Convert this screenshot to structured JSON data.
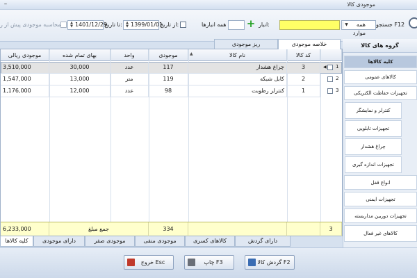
{
  "window": {
    "title": "موجودی کالا",
    "minimize": "–"
  },
  "toolbar": {
    "search_label": "جستجو F12",
    "all_items": "همه موارد",
    "warehouse_label": "انبار:",
    "all_warehouses": "همه انبارها",
    "from_date_label": "از تاریخ:",
    "from_date": "1399/01/01",
    "to_date_label": "تا تاریخ:",
    "to_date": "1401/12/29",
    "calc_prev_label": "محاسبه موجودی پیش از ر"
  },
  "sidebar": {
    "header": "گروه های کالا",
    "items": [
      {
        "label": "کلیه کالاها"
      },
      {
        "label": "کالاهای عمومی"
      },
      {
        "label": "تجهیزات حفاظت الکتریکی"
      },
      {
        "label": "کنترلر و نمایشگر"
      },
      {
        "label": "تجهیزات تابلویی"
      },
      {
        "label": "چراغ هشدار"
      },
      {
        "label": "تجهیزات اندازه گیری"
      },
      {
        "label": "انواع قفل"
      },
      {
        "label": "تجهیزات ایمنی"
      },
      {
        "label": "تجهیزات دوربین مداربسته"
      },
      {
        "label": "کالاهای غیر فعال"
      }
    ]
  },
  "tabs_top": [
    {
      "label": "خلاصه موجودی"
    },
    {
      "label": "ریز موجودی"
    }
  ],
  "grid": {
    "columns": {
      "code": "کد کالا",
      "name": "نام کالا",
      "stock": "موجودی",
      "unit": "واحد",
      "price": "بهای تمام شده",
      "value": "موجودی ریالی"
    },
    "rows": [
      {
        "idx": "1",
        "code": "3",
        "name": "چراغ هشدار",
        "stock": "117",
        "unit": "عدد",
        "price": "30,000",
        "value": "3,510,000"
      },
      {
        "idx": "2",
        "code": "2",
        "name": "کابل شبکه",
        "stock": "119",
        "unit": "متر",
        "price": "13,000",
        "value": "1,547,000"
      },
      {
        "idx": "3",
        "code": "1",
        "name": "کنترلر رطوبت",
        "stock": "98",
        "unit": "عدد",
        "price": "12,000",
        "value": "1,176,000"
      }
    ],
    "footer": {
      "count": "3",
      "stock_total": "334",
      "sum_label": "جمع مبلغ",
      "value_total": "6,233,000"
    }
  },
  "tabs_bottom": [
    {
      "label": "دارای گردش"
    },
    {
      "label": "کالاهای کسری"
    },
    {
      "label": "موجودی منفی"
    },
    {
      "label": "موجودی صفر"
    },
    {
      "label": "دارای موجودی"
    },
    {
      "label": "کلیه کالاها"
    }
  ],
  "buttons": {
    "turnover": "گردش کالا F2",
    "print": "چاپ F3",
    "exit": "خروج Esc"
  },
  "colors": {
    "yellow_input": "#ffff66",
    "plus_green": "#23a123",
    "footer_bg": "#ffffcc",
    "selected_row": "#e3e3e3"
  }
}
